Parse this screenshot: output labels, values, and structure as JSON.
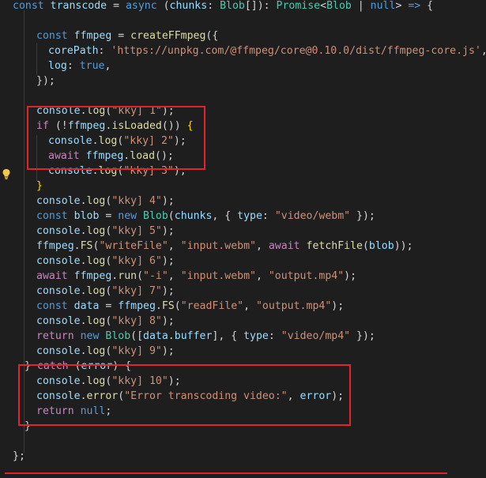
{
  "editor": {
    "language": "typescript",
    "lines": [
      {
        "tokens": [
          [
            "kw",
            "const"
          ],
          [
            "plain",
            " "
          ],
          [
            "var",
            "transcode"
          ],
          [
            "plain",
            " = "
          ],
          [
            "kw",
            "async"
          ],
          [
            "plain",
            " ("
          ],
          [
            "var",
            "chunks"
          ],
          [
            "plain",
            ": "
          ],
          [
            "type",
            "Blob"
          ],
          [
            "plain",
            "[]): "
          ],
          [
            "type",
            "Promise"
          ],
          [
            "plain",
            "<"
          ],
          [
            "type",
            "Blob"
          ],
          [
            "plain",
            " | "
          ],
          [
            "kw",
            "null"
          ],
          [
            "plain",
            "> "
          ],
          [
            "kw",
            "=>"
          ],
          [
            "plain",
            " {"
          ]
        ]
      },
      {
        "tokens": []
      },
      {
        "tokens": [
          [
            "kw",
            "const"
          ],
          [
            "plain",
            " "
          ],
          [
            "var",
            "ffmpeg"
          ],
          [
            "plain",
            " = "
          ],
          [
            "fn",
            "createFFmpeg"
          ],
          [
            "plain",
            "({"
          ]
        ]
      },
      {
        "tokens": [
          [
            "var",
            "corePath"
          ],
          [
            "plain",
            ": "
          ],
          [
            "str",
            "'https://unpkg.com/@ffmpeg/core@0.10.0/dist/ffmpeg-core.js'"
          ],
          [
            "plain",
            ","
          ]
        ]
      },
      {
        "tokens": [
          [
            "var",
            "log"
          ],
          [
            "plain",
            ": "
          ],
          [
            "kw",
            "true"
          ],
          [
            "plain",
            ","
          ]
        ]
      },
      {
        "tokens": [
          [
            "plain",
            "});"
          ]
        ]
      },
      {
        "tokens": []
      },
      {
        "tokens": [
          [
            "var",
            "console"
          ],
          [
            "plain",
            "."
          ],
          [
            "fn",
            "log"
          ],
          [
            "plain",
            "("
          ],
          [
            "str",
            "\"kky] 1\""
          ],
          [
            "plain",
            ");"
          ]
        ]
      },
      {
        "tokens": [
          [
            "kw-ctrl",
            "if"
          ],
          [
            "plain",
            " (!"
          ],
          [
            "var",
            "ffmpeg"
          ],
          [
            "plain",
            "."
          ],
          [
            "fn",
            "isLoaded"
          ],
          [
            "plain",
            "()) "
          ],
          [
            "bracket",
            "{"
          ]
        ]
      },
      {
        "tokens": [
          [
            "var",
            "console"
          ],
          [
            "plain",
            "."
          ],
          [
            "fn",
            "log"
          ],
          [
            "plain",
            "("
          ],
          [
            "str",
            "\"kky] 2\""
          ],
          [
            "plain",
            ");"
          ]
        ]
      },
      {
        "tokens": [
          [
            "kw-ctrl",
            "await"
          ],
          [
            "plain",
            " "
          ],
          [
            "var",
            "ffmpeg"
          ],
          [
            "plain",
            "."
          ],
          [
            "fn",
            "load"
          ],
          [
            "plain",
            "();"
          ]
        ]
      },
      {
        "tokens": [
          [
            "var",
            "console"
          ],
          [
            "plain",
            "."
          ],
          [
            "fn",
            "log"
          ],
          [
            "plain",
            "("
          ],
          [
            "str",
            "\"kky] 3\""
          ],
          [
            "plain",
            ");"
          ]
        ]
      },
      {
        "tokens": [
          [
            "bracket",
            "}"
          ]
        ]
      },
      {
        "tokens": [
          [
            "var",
            "console"
          ],
          [
            "plain",
            "."
          ],
          [
            "fn",
            "log"
          ],
          [
            "plain",
            "("
          ],
          [
            "str",
            "\"kky] 4\""
          ],
          [
            "plain",
            ");"
          ]
        ]
      },
      {
        "tokens": [
          [
            "kw",
            "const"
          ],
          [
            "plain",
            " "
          ],
          [
            "var",
            "blob"
          ],
          [
            "plain",
            " = "
          ],
          [
            "kw",
            "new"
          ],
          [
            "plain",
            " "
          ],
          [
            "type",
            "Blob"
          ],
          [
            "plain",
            "("
          ],
          [
            "var",
            "chunks"
          ],
          [
            "plain",
            ", { "
          ],
          [
            "var",
            "type"
          ],
          [
            "plain",
            ": "
          ],
          [
            "str",
            "\"video/webm\""
          ],
          [
            "plain",
            " });"
          ]
        ]
      },
      {
        "tokens": [
          [
            "var",
            "console"
          ],
          [
            "plain",
            "."
          ],
          [
            "fn",
            "log"
          ],
          [
            "plain",
            "("
          ],
          [
            "str",
            "\"kky] 5\""
          ],
          [
            "plain",
            ");"
          ]
        ]
      },
      {
        "tokens": [
          [
            "var",
            "ffmpeg"
          ],
          [
            "plain",
            "."
          ],
          [
            "fn",
            "FS"
          ],
          [
            "plain",
            "("
          ],
          [
            "str",
            "\"writeFile\""
          ],
          [
            "plain",
            ", "
          ],
          [
            "str",
            "\"input.webm\""
          ],
          [
            "plain",
            ", "
          ],
          [
            "kw-ctrl",
            "await"
          ],
          [
            "plain",
            " "
          ],
          [
            "fn",
            "fetchFile"
          ],
          [
            "plain",
            "("
          ],
          [
            "var",
            "blob"
          ],
          [
            "plain",
            "));"
          ]
        ]
      },
      {
        "tokens": [
          [
            "var",
            "console"
          ],
          [
            "plain",
            "."
          ],
          [
            "fn",
            "log"
          ],
          [
            "plain",
            "("
          ],
          [
            "str",
            "\"kky] 6\""
          ],
          [
            "plain",
            ");"
          ]
        ]
      },
      {
        "tokens": [
          [
            "kw-ctrl",
            "await"
          ],
          [
            "plain",
            " "
          ],
          [
            "var",
            "ffmpeg"
          ],
          [
            "plain",
            "."
          ],
          [
            "fn",
            "run"
          ],
          [
            "plain",
            "("
          ],
          [
            "str",
            "\"-i\""
          ],
          [
            "plain",
            ", "
          ],
          [
            "str",
            "\"input.webm\""
          ],
          [
            "plain",
            ", "
          ],
          [
            "str",
            "\"output.mp4\""
          ],
          [
            "plain",
            ");"
          ]
        ]
      },
      {
        "tokens": [
          [
            "var",
            "console"
          ],
          [
            "plain",
            "."
          ],
          [
            "fn",
            "log"
          ],
          [
            "plain",
            "("
          ],
          [
            "str",
            "\"kky] 7\""
          ],
          [
            "plain",
            ");"
          ]
        ]
      },
      {
        "tokens": [
          [
            "kw",
            "const"
          ],
          [
            "plain",
            " "
          ],
          [
            "var",
            "data"
          ],
          [
            "plain",
            " = "
          ],
          [
            "var",
            "ffmpeg"
          ],
          [
            "plain",
            "."
          ],
          [
            "fn",
            "FS"
          ],
          [
            "plain",
            "("
          ],
          [
            "str",
            "\"readFile\""
          ],
          [
            "plain",
            ", "
          ],
          [
            "str",
            "\"output.mp4\""
          ],
          [
            "plain",
            ");"
          ]
        ]
      },
      {
        "tokens": [
          [
            "var",
            "console"
          ],
          [
            "plain",
            "."
          ],
          [
            "fn",
            "log"
          ],
          [
            "plain",
            "("
          ],
          [
            "str",
            "\"kky] 8\""
          ],
          [
            "plain",
            ");"
          ]
        ]
      },
      {
        "tokens": [
          [
            "kw-ctrl",
            "return"
          ],
          [
            "plain",
            " "
          ],
          [
            "kw",
            "new"
          ],
          [
            "plain",
            " "
          ],
          [
            "type",
            "Blob"
          ],
          [
            "plain",
            "(["
          ],
          [
            "var",
            "data"
          ],
          [
            "plain",
            "."
          ],
          [
            "var",
            "buffer"
          ],
          [
            "plain",
            "], { "
          ],
          [
            "var",
            "type"
          ],
          [
            "plain",
            ": "
          ],
          [
            "str",
            "\"video/mp4\""
          ],
          [
            "plain",
            " });"
          ]
        ]
      },
      {
        "tokens": [
          [
            "var",
            "console"
          ],
          [
            "plain",
            "."
          ],
          [
            "fn",
            "log"
          ],
          [
            "plain",
            "("
          ],
          [
            "str",
            "\"kky] 9\""
          ],
          [
            "plain",
            ");"
          ]
        ]
      },
      {
        "tokens": [
          [
            "plain",
            "} "
          ],
          [
            "kw-ctrl",
            "catch"
          ],
          [
            "plain",
            " ("
          ],
          [
            "var",
            "error"
          ],
          [
            "plain",
            ") {"
          ]
        ]
      },
      {
        "tokens": [
          [
            "var",
            "console"
          ],
          [
            "plain",
            "."
          ],
          [
            "fn",
            "log"
          ],
          [
            "plain",
            "("
          ],
          [
            "str",
            "\"kky] 10\""
          ],
          [
            "plain",
            ");"
          ]
        ]
      },
      {
        "tokens": [
          [
            "var",
            "console"
          ],
          [
            "plain",
            "."
          ],
          [
            "fn",
            "error"
          ],
          [
            "plain",
            "("
          ],
          [
            "str",
            "\"Error transcoding video:\""
          ],
          [
            "plain",
            ", "
          ],
          [
            "var",
            "error"
          ],
          [
            "plain",
            ");"
          ]
        ]
      },
      {
        "tokens": [
          [
            "kw-ctrl",
            "return"
          ],
          [
            "plain",
            " "
          ],
          [
            "kw",
            "null"
          ],
          [
            "plain",
            ";"
          ]
        ]
      },
      {
        "tokens": [
          [
            "plain",
            "}"
          ]
        ]
      },
      {
        "tokens": []
      },
      {
        "tokens": [
          [
            "plain",
            "};"
          ]
        ]
      }
    ]
  },
  "icons": {
    "lightbulb": "lightbulb-icon"
  },
  "colors": {
    "background": "#1e1e1e",
    "highlight_box": "#e0242c",
    "lightbulb": "#f2c94c"
  }
}
